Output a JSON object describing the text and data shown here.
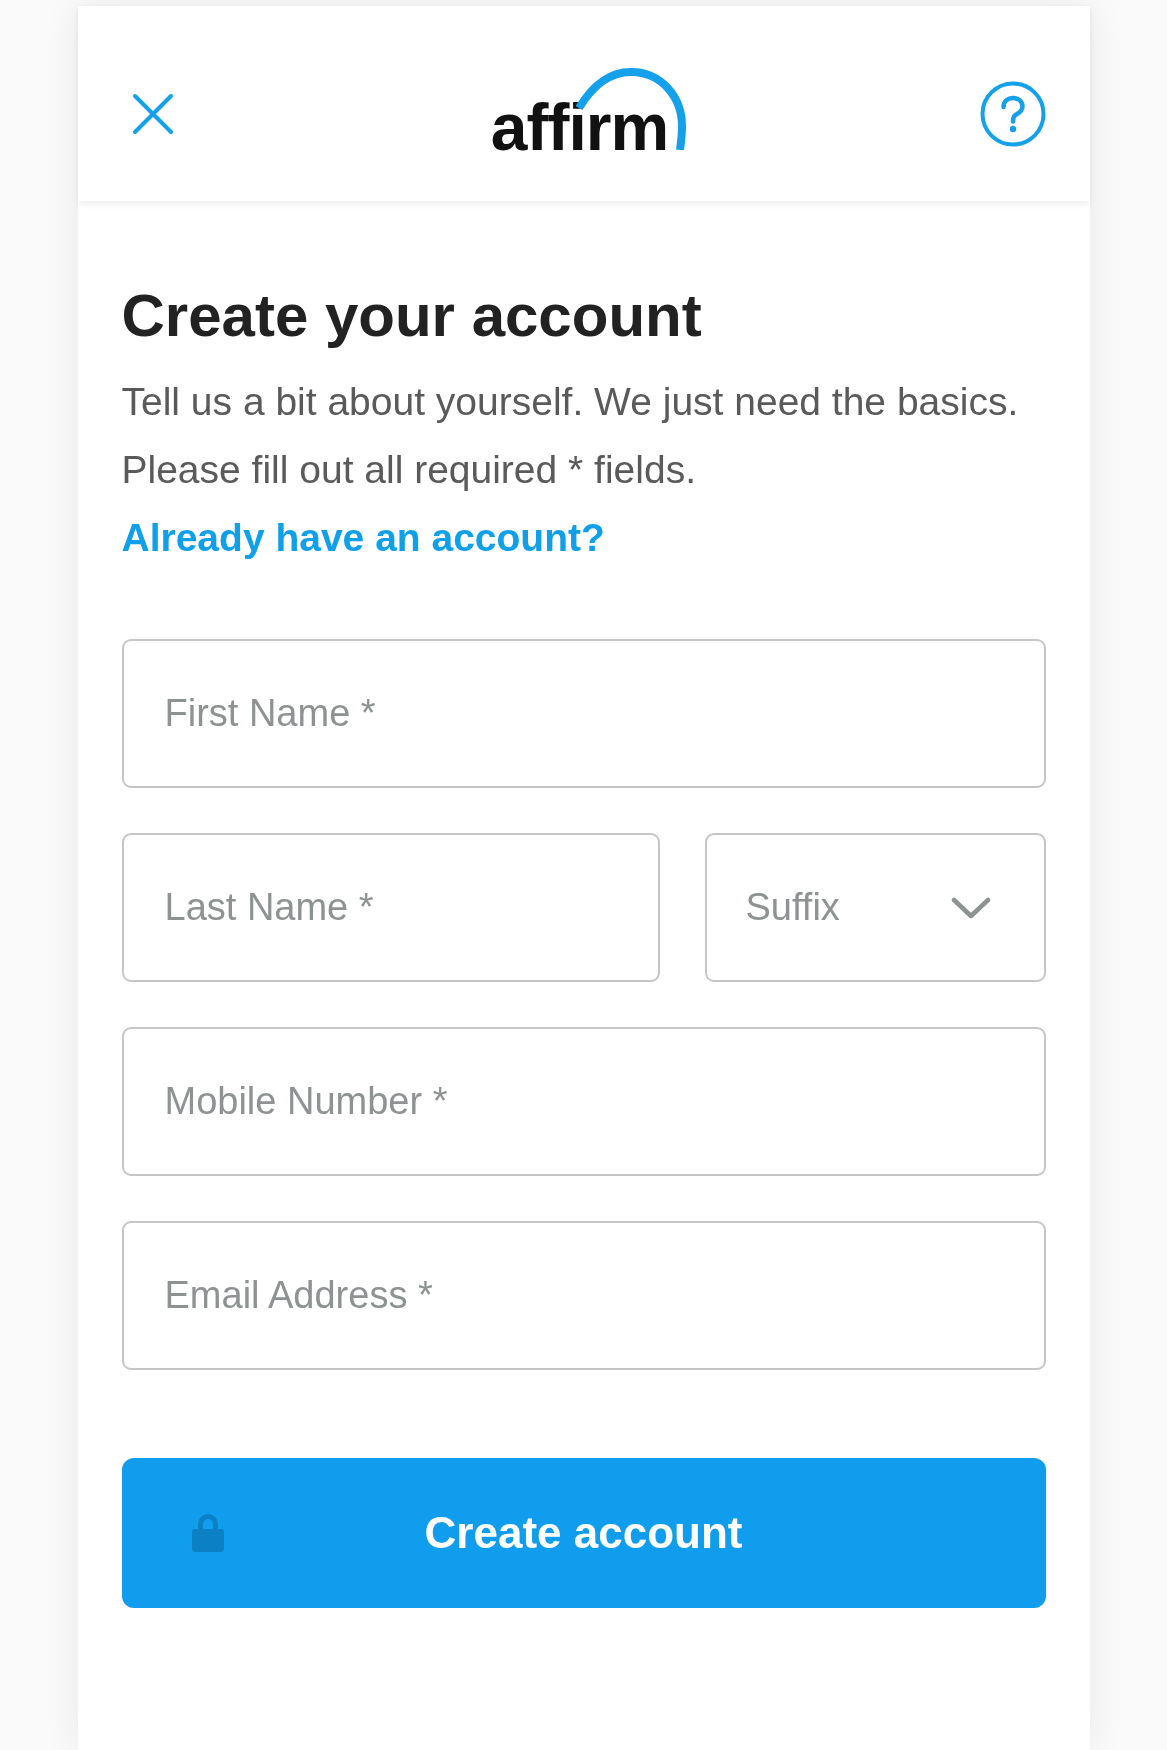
{
  "header": {
    "logo_text": "affirm"
  },
  "title": "Create your account",
  "intro": {
    "text": "Tell us a bit about yourself. We just need the basics. Please fill out all required * fields.",
    "link": "Already have an account?"
  },
  "form": {
    "rows": [
      [
        {
          "kind": "text",
          "placeholder": "First Name *"
        }
      ],
      [
        {
          "kind": "text",
          "placeholder": "Last Name *"
        },
        {
          "kind": "select",
          "placeholder": "Suffix"
        }
      ],
      [
        {
          "kind": "text",
          "placeholder": "Mobile Number *"
        }
      ],
      [
        {
          "kind": "text",
          "placeholder": "Email Address *"
        }
      ]
    ]
  },
  "submit": {
    "label": "Create account"
  }
}
